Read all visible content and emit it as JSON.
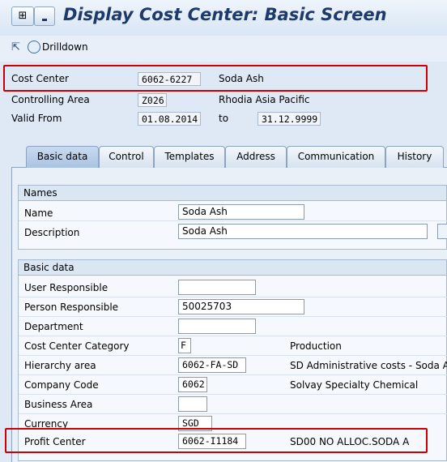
{
  "title": "Display Cost Center: Basic Screen",
  "toolbar": {
    "drilldown_label": "Drilldown"
  },
  "header": {
    "cost_center_label": "Cost Center",
    "cost_center_value": "6062-6227",
    "cost_center_name": "Soda Ash",
    "controlling_area_label": "Controlling Area",
    "controlling_area_value": "Z026",
    "controlling_area_name": "Rhodia Asia Pacific",
    "valid_from_label": "Valid From",
    "valid_from_value": "01.08.2014",
    "to_label": "to",
    "valid_to_value": "31.12.9999"
  },
  "tabs": [
    {
      "label": "Basic data"
    },
    {
      "label": "Control"
    },
    {
      "label": "Templates"
    },
    {
      "label": "Address"
    },
    {
      "label": "Communication"
    },
    {
      "label": "History"
    }
  ],
  "names_group": {
    "title": "Names",
    "name_label": "Name",
    "name_value": "Soda Ash",
    "description_label": "Description",
    "description_value": "Soda Ash"
  },
  "basic_group": {
    "title": "Basic data",
    "user_responsible_label": "User Responsible",
    "user_responsible_value": "",
    "person_responsible_label": "Person Responsible",
    "person_responsible_value": "50025703",
    "department_label": "Department",
    "department_value": "",
    "category_label": "Cost Center Category",
    "category_value": "F",
    "category_text": "Production",
    "hierarchy_label": "Hierarchy area",
    "hierarchy_value": "6062-FA-SD",
    "hierarchy_text": "SD Administrative costs - Soda As",
    "company_code_label": "Company Code",
    "company_code_value": "6062",
    "company_code_text": "Solvay Specialty Chemical",
    "business_area_label": "Business Area",
    "business_area_value": "",
    "currency_label": "Currency",
    "currency_value": "SGD",
    "profit_center_label": "Profit Center",
    "profit_center_value": "6062-I1184",
    "profit_center_text": "SD00 NO ALLOC.SODA A"
  },
  "colors": {
    "title": "#1d3a6b",
    "highlight": "#cc0000",
    "background": "#dfe9f5"
  }
}
